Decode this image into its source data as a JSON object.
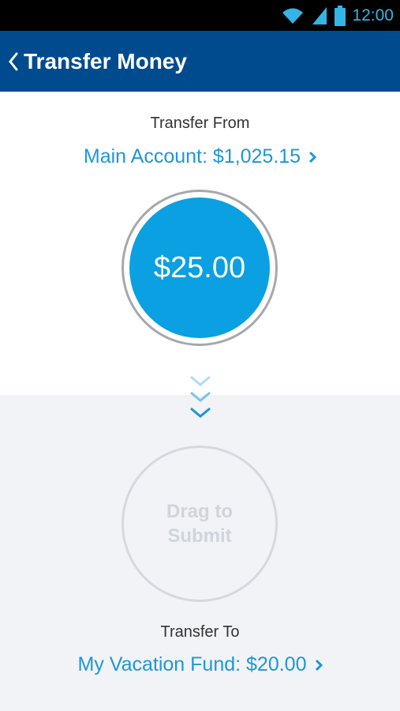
{
  "status_bar": {
    "time": "12:00"
  },
  "app_bar": {
    "title": "Transfer Money"
  },
  "transfer_from": {
    "label": "Transfer From",
    "account": "Main Account: $1,025.15"
  },
  "amount": "$25.00",
  "drop_target": {
    "line1": "Drag to",
    "line2": "Submit"
  },
  "transfer_to": {
    "label": "Transfer To",
    "account": "My Vacation Fund: $20.00"
  },
  "colors": {
    "app_bar": "#004b8d",
    "accent": "#0aa0e2",
    "link": "#1e97d8"
  },
  "icons": [
    "wifi-icon",
    "signal-icon",
    "battery-icon",
    "back-chevron-icon",
    "chevron-right-icon",
    "chevron-down-icon"
  ]
}
